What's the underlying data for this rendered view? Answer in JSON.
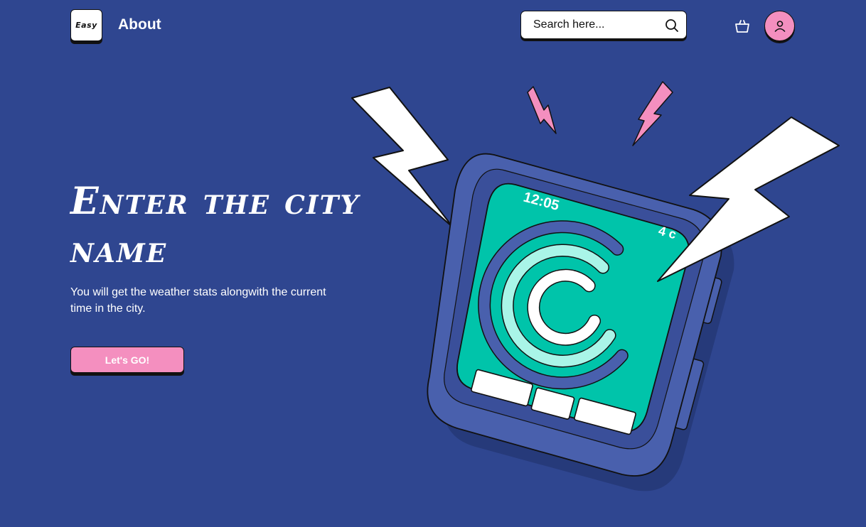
{
  "header": {
    "logo_text": "Easy",
    "nav_about": "About",
    "search_placeholder": "Search here..."
  },
  "hero": {
    "title_line1": "Enter the city",
    "title_line2": "name",
    "subtitle": "You will get the weather stats alongwith the current time in the city.",
    "cta_label": "Let's GO!"
  },
  "watch": {
    "time": "12:05",
    "temperature": "4 c"
  },
  "colors": {
    "background": "#2f4690",
    "accent_pink": "#f48fbf",
    "screen_teal": "#00c4aa",
    "arc_light": "#a9f5e8",
    "watch_frame": "#4960ad"
  }
}
